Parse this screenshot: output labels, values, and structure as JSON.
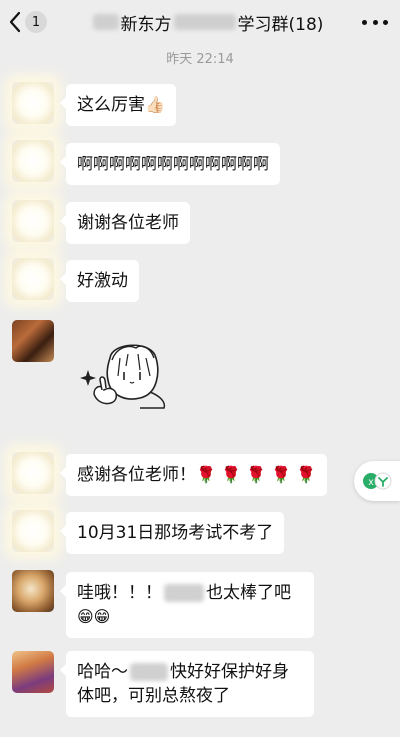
{
  "header": {
    "back_badge": "1",
    "title_middle": "新东方",
    "title_suffix": "学习群(18)"
  },
  "timestamp": "昨天 22:14",
  "messages": [
    {
      "text": "这么厉害",
      "emoji": "👍🏻"
    },
    {
      "text": "啊啊啊啊啊啊啊啊啊啊啊啊"
    },
    {
      "text": "谢谢各位老师"
    },
    {
      "text": "好激动"
    },
    {
      "sticker": "drawn-face-thumbs-up-sticker"
    },
    {
      "text": "感谢各位老师！",
      "emoji": "🌹 🌹 🌹 🌹 🌹"
    },
    {
      "text": "10月31日那场考试不考了"
    },
    {
      "text_before": "哇哦！！！",
      "text_after": "也太棒了吧",
      "emoji": "😁😁"
    },
    {
      "line1_start": "哈哈～",
      "line1_end": "快好好保护好身",
      "line2": "体吧，可别总熬夜了"
    }
  ],
  "float_button": {
    "icon": "wecom-icon"
  }
}
